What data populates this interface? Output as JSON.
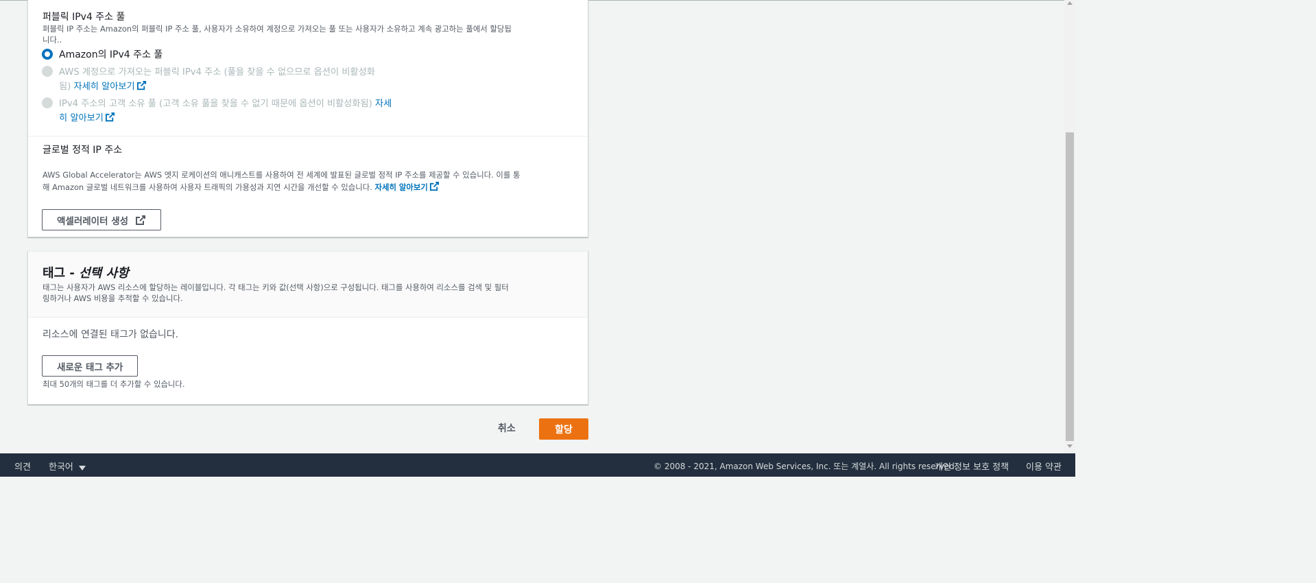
{
  "ip_pool": {
    "title": "퍼블릭 IPv4 주소 풀",
    "desc_line1": "퍼블릭 IP 주소는 Amazon의 퍼블릭 IP 주소 풀, 사용자가 소유하여 계정으로 가져오는 풀 또는 사용자가 소유하고 계속 광고하는 풀에서 할당됩",
    "desc_line2": "니다..",
    "options": [
      {
        "label": "Amazon의 IPv4 주소 풀",
        "selected": true,
        "disabled": false
      },
      {
        "label_line1": "AWS 계정으로 가져오는 퍼블릭 IPv4 주소 (풀을 찾을 수 없으므로 옵션이 비활성화",
        "label_line2": "됨)",
        "link": "자세히 알아보기",
        "selected": false,
        "disabled": true
      },
      {
        "label_line1": "IPv4 주소의 고객 소유 풀 (고객 소유 풀을 찾을 수 없기 때문에 옵션이 비활성화됨)",
        "link_part1": "자세",
        "link_part2": "히 알아보기",
        "selected": false,
        "disabled": true
      }
    ]
  },
  "global_ip": {
    "title": "글로벌 정적 IP 주소",
    "desc_line1": "AWS Global Accelerator는 AWS 엣지 로케이션의 애니캐스트를 사용하여 전 세계에 발표된 글로벌 정적 IP 주소를 제공할 수 있습니다. 이를 통",
    "desc_line2": "해 Amazon 글로벌 네트워크를 사용하여 사용자 트래픽의 가용성과 지연 시간을 개선할 수 있습니다.",
    "link": "자세히 알아보기",
    "button": "액셀러레이터 생성"
  },
  "tags": {
    "title_prefix": "태그 - ",
    "title_italic": "선택 사항",
    "desc_line1": "태그는 사용자가 AWS 리소스에 할당하는 레이블입니다. 각 태그는 키와 값(선택 사항)으로 구성됩니다. 태그를 사용하여 리소스를 검색 및 필터",
    "desc_line2": "링하거나 AWS 비용을 추적할 수 있습니다.",
    "empty": "리소스에 연결된 태그가 없습니다.",
    "add_button": "새로운 태그 추가",
    "limit": "최대 50개의 태그를 더 추가할 수 있습니다."
  },
  "actions": {
    "cancel": "취소",
    "submit": "할당"
  },
  "footer": {
    "feedback": "의견",
    "language": "한국어",
    "copyright": "© 2008 - 2021, Amazon Web Services, Inc. 또는 계열사. All rights reserved.",
    "privacy": "개인 정보 보호 정책",
    "terms": "이용 약관"
  },
  "colors": {
    "link": "#0073bb",
    "primary": "#ec7211",
    "footer_bg": "#232f3e"
  }
}
